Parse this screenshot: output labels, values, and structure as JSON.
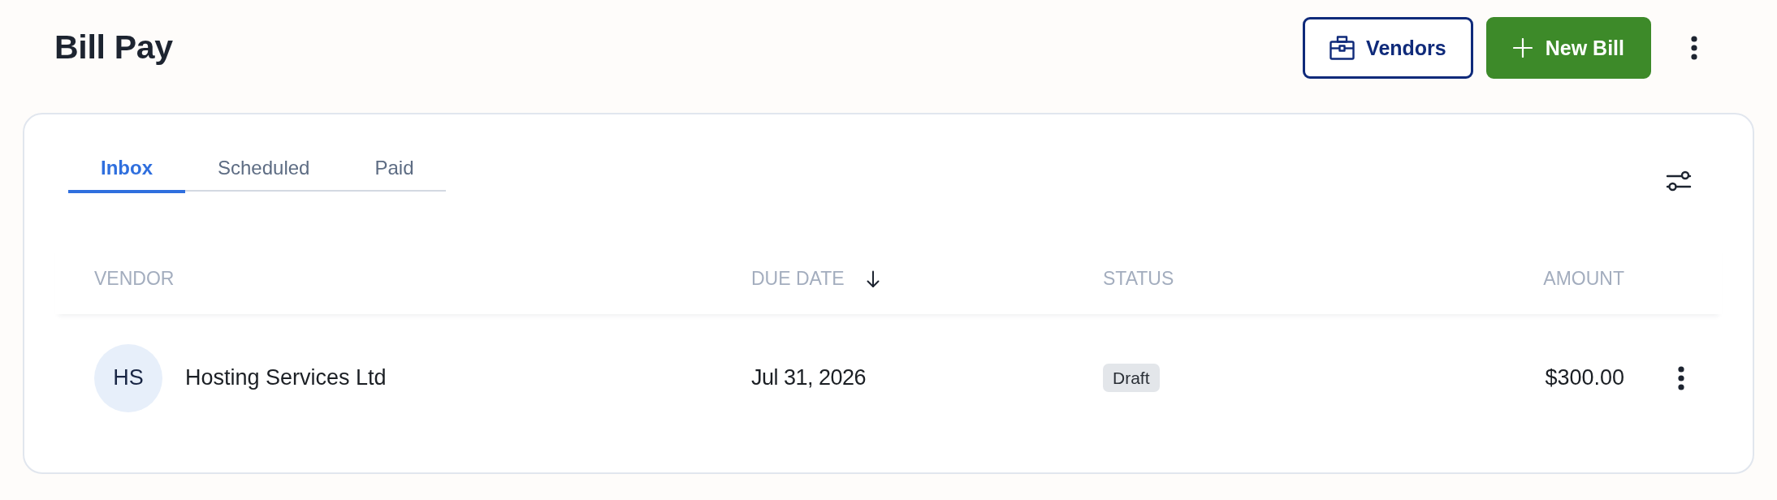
{
  "header": {
    "title": "Bill Pay",
    "buttons": [
      {
        "kind": "outline",
        "label": "Vendors"
      },
      {
        "kind": "solid",
        "label": "New Bill"
      }
    ]
  },
  "tabs": [
    {
      "label": "Inbox",
      "selected": true
    },
    {
      "label": "Scheduled",
      "selected": false
    },
    {
      "label": "Paid",
      "selected": false
    }
  ],
  "table": {
    "columns": [
      {
        "label": "VENDOR"
      },
      {
        "label": "DUE DATE",
        "sort_descending": true
      },
      {
        "label": "STATUS"
      },
      {
        "label": "AMOUNT"
      }
    ],
    "rows": [
      {
        "initials": "HS",
        "vendor": "Hosting Services Ltd",
        "due_date": "Jul 31, 2026",
        "status": "Draft",
        "amount": "$300.00"
      }
    ]
  }
}
